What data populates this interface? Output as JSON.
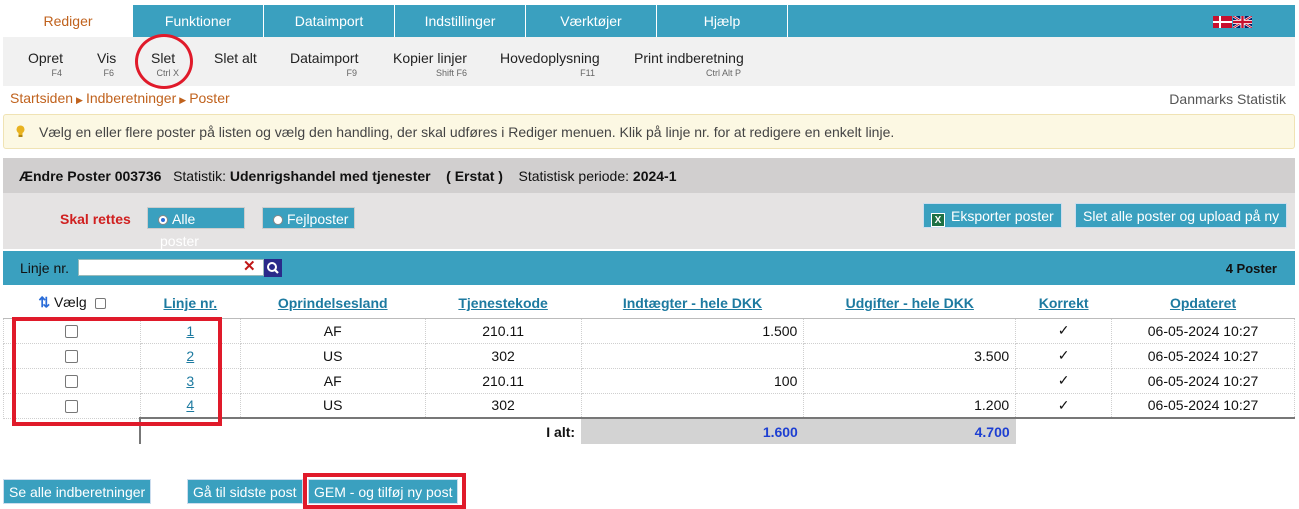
{
  "menu": {
    "tabs": [
      "Rediger",
      "Funktioner",
      "Dataimport",
      "Indstillinger",
      "Værktøjer",
      "Hjælp"
    ],
    "active": "Rediger"
  },
  "ribbon": [
    {
      "label": "Opret",
      "shortcut": "F4"
    },
    {
      "label": "Vis",
      "shortcut": "F6"
    },
    {
      "label": "Slet",
      "shortcut": "Ctrl X"
    },
    {
      "label": "Slet alt",
      "shortcut": ""
    },
    {
      "label": "Dataimport",
      "shortcut": "F9"
    },
    {
      "label": "Kopier linjer",
      "shortcut": "Shift F6"
    },
    {
      "label": "Hovedoplysning",
      "shortcut": "F11"
    },
    {
      "label": "Print indberetning",
      "shortcut": "Ctrl Alt P"
    }
  ],
  "breadcrumb": [
    "Startsiden",
    "Indberetninger",
    "Poster"
  ],
  "organization": "Danmarks Statistik",
  "hint": "Vælg en eller flere poster på listen og vælg den handling, der skal udføres i Rediger menuen. Klik på linje nr. for at redigere en enkelt linje.",
  "header": {
    "title": "Ændre Poster 003736",
    "statistik_label": "Statistik:",
    "statistik_value": "Udenrigshandel med tjenester",
    "type": "( Erstat )",
    "periode_label": "Statistisk periode:",
    "periode_value": "2024-1"
  },
  "filter": {
    "label": "Skal rettes",
    "option_all": "Alle poster",
    "option_errors": "Fejlposter",
    "selected": "Alle poster"
  },
  "actions": {
    "export": "Eksporter poster",
    "delete_upload": "Slet alle poster og upload på ny"
  },
  "search": {
    "label": "Linje nr.",
    "value": "",
    "count": "4 Poster"
  },
  "table": {
    "columns": [
      "Vælg",
      "Linje nr.",
      "Oprindelsesland",
      "Tjenestekode",
      "Indtægter - hele DKK",
      "Udgifter - hele DKK",
      "Korrekt",
      "Opdateret"
    ],
    "rows": [
      {
        "linje": "1",
        "land": "AF",
        "kode": "210.11",
        "indt": "1.500",
        "udg": "",
        "korrekt": "✓",
        "opdateret": "06-05-2024 10:27"
      },
      {
        "linje": "2",
        "land": "US",
        "kode": "302",
        "indt": "",
        "udg": "3.500",
        "korrekt": "✓",
        "opdateret": "06-05-2024 10:27"
      },
      {
        "linje": "3",
        "land": "AF",
        "kode": "210.11",
        "indt": "100",
        "udg": "",
        "korrekt": "✓",
        "opdateret": "06-05-2024 10:27"
      },
      {
        "linje": "4",
        "land": "US",
        "kode": "302",
        "indt": "",
        "udg": "1.200",
        "korrekt": "✓",
        "opdateret": "06-05-2024 10:27"
      }
    ],
    "total_label": "I alt:",
    "total_indt": "1.600",
    "total_udg": "4.700"
  },
  "bottom": {
    "see_all": "Se alle indberetninger",
    "last_post": "Gå til sidste post",
    "save_add": "GEM - og tilføj ny post"
  },
  "colors": {
    "accent": "#3aa0bf",
    "active_text": "#c0621d",
    "link": "#1d7aa0",
    "annotation": "#e01a2a",
    "total_value": "#1d3fd2"
  }
}
